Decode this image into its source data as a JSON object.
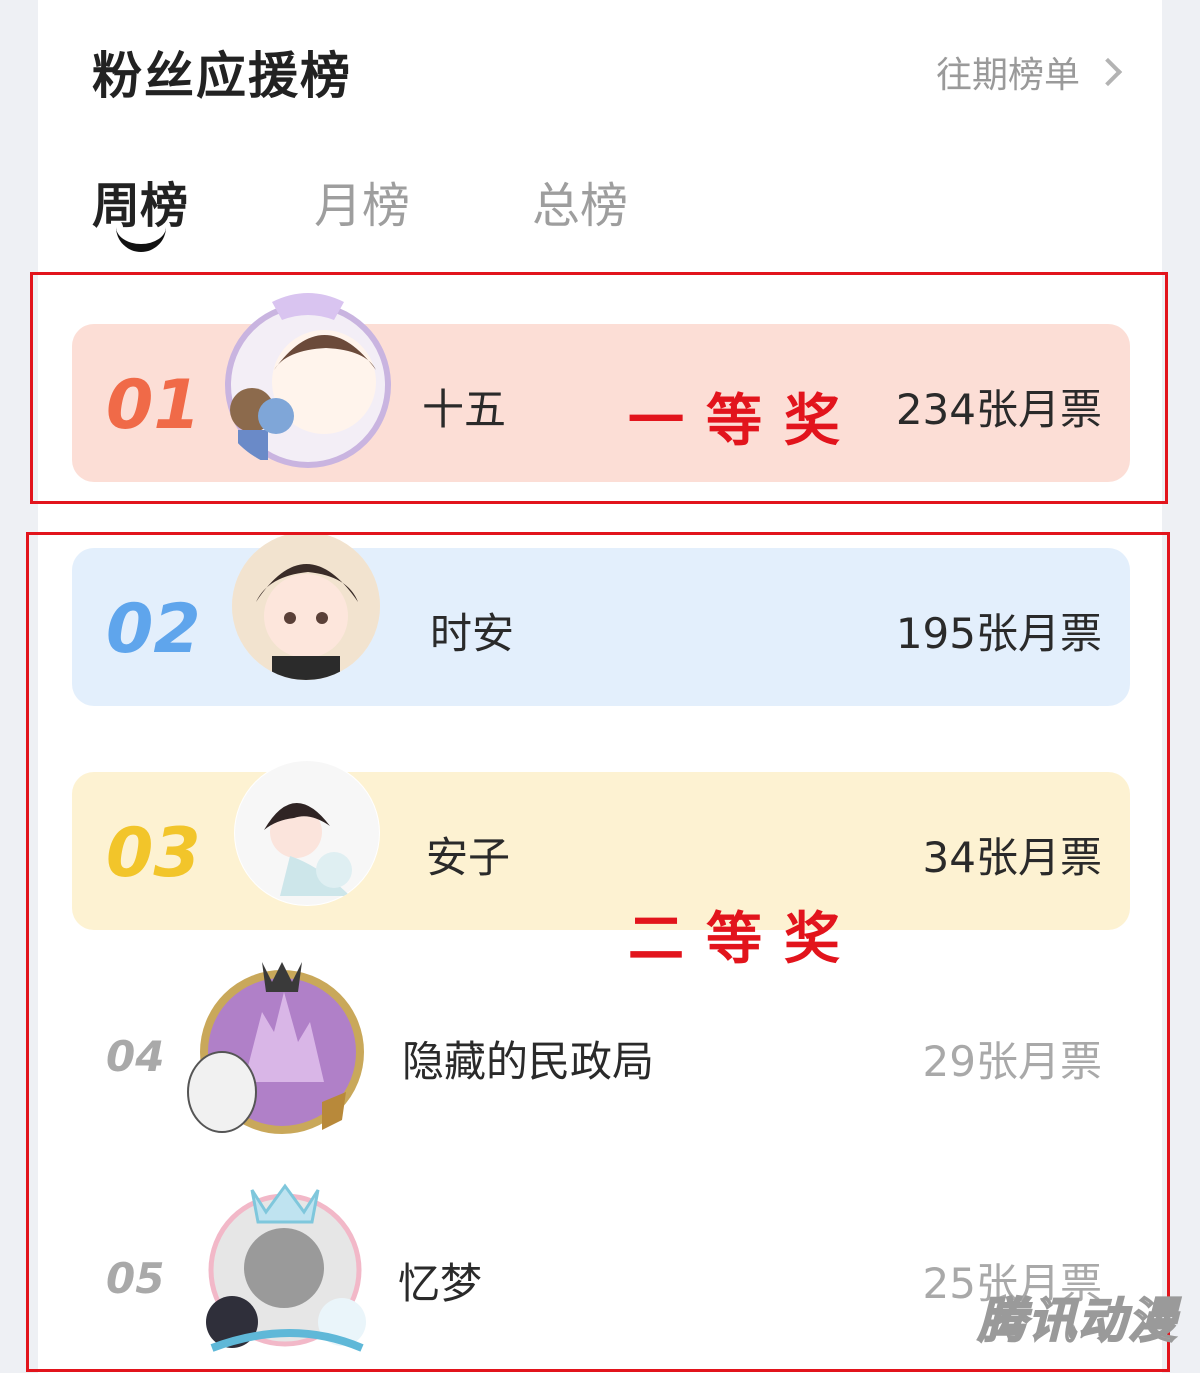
{
  "header": {
    "title": "粉丝应援榜",
    "history_label": "往期榜单"
  },
  "tabs": [
    {
      "label": "周榜",
      "active": true
    },
    {
      "label": "月榜",
      "active": false
    },
    {
      "label": "总榜",
      "active": false
    }
  ],
  "rankings": [
    {
      "rank": "01",
      "name": "十五",
      "votes": "234张月票",
      "bg": "#fcded6",
      "rank_color": "#f06a48"
    },
    {
      "rank": "02",
      "name": "时安",
      "votes": "195张月票",
      "bg": "#e3effc",
      "rank_color": "#5fa5ec"
    },
    {
      "rank": "03",
      "name": "安子",
      "votes": "34张月票",
      "bg": "#fdf2d2",
      "rank_color": "#f2c52a"
    },
    {
      "rank": "04",
      "name": "隐藏的民政局",
      "votes": "29张月票"
    },
    {
      "rank": "05",
      "name": "忆梦",
      "votes": "25张月票"
    }
  ],
  "annotations": {
    "first_prize": "一等奖",
    "second_prize": "二等奖"
  },
  "watermark": "腾讯动漫",
  "colors": {
    "annotation": "#e2141c",
    "active_tab": "#222222",
    "inactive": "#9e9e9e"
  }
}
